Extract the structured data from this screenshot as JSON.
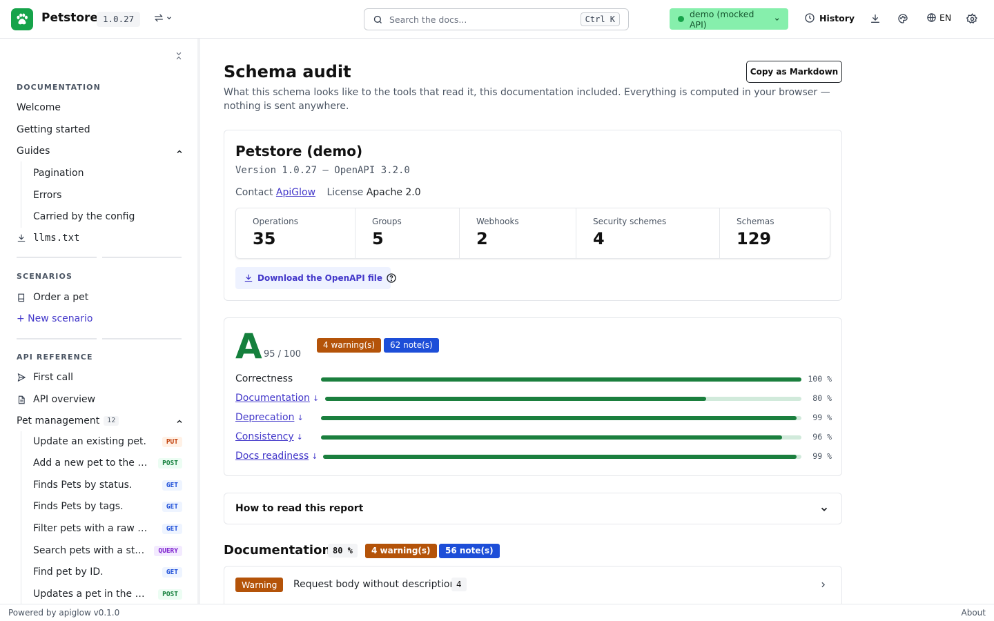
{
  "header": {
    "brand": "Petstore",
    "version": "1.0.27",
    "search_placeholder": "Search the docs...",
    "search_shortcut": "Ctrl K",
    "environment": "demo (mocked API)",
    "history_label": "History",
    "language": "EN"
  },
  "sidebar": {
    "documentation_title": "DOCUMENTATION",
    "doc_items": [
      "Welcome",
      "Getting started",
      "Guides"
    ],
    "guide_items": [
      "Pagination",
      "Errors",
      "Carried by the config"
    ],
    "llms_label": "llms.txt",
    "scenarios_title": "SCENARIOS",
    "scenario_item": "Order a pet",
    "new_scenario": "+ New scenario",
    "api_title": "API REFERENCE",
    "api_items": [
      "First call",
      "API overview"
    ],
    "group_label": "Pet management",
    "group_count": "12",
    "operations": [
      {
        "name": "Update an existing pet.",
        "method": "PUT"
      },
      {
        "name": "Add a new pet to the st...",
        "method": "POST"
      },
      {
        "name": "Finds Pets by status.",
        "method": "GET"
      },
      {
        "name": "Finds Pets by tags.",
        "method": "GET"
      },
      {
        "name": "Filter pets with a raw qu...",
        "method": "GET"
      },
      {
        "name": "Search pets with a stru...",
        "method": "QUERY"
      },
      {
        "name": "Find pet by ID.",
        "method": "GET"
      },
      {
        "name": "Updates a pet in the st...",
        "method": "POST"
      }
    ]
  },
  "main": {
    "title": "Schema audit",
    "copy_button": "Copy as Markdown",
    "intro": "What this schema looks like to the tools that read it, this documentation included. Everything is computed in your browser — nothing is sent anywhere.",
    "api": {
      "title": "Petstore (demo)",
      "version_line": "Version 1.0.27 — OpenAPI 3.2.0",
      "contact_label": "Contact",
      "contact_value": "ApiGlow",
      "license_label": "License",
      "license_value": "Apache 2.0",
      "stats": [
        {
          "label": "Operations",
          "value": "35"
        },
        {
          "label": "Groups",
          "value": "5"
        },
        {
          "label": "Webhooks",
          "value": "2"
        },
        {
          "label": "Security schemes",
          "value": "4"
        },
        {
          "label": "Schemas",
          "value": "129"
        }
      ],
      "download_label": "Download the OpenAPI file"
    },
    "score": {
      "grade": "A",
      "score_text": "95 / 100",
      "warnings": "4 warning(s)",
      "notes": "62 note(s)",
      "rows": [
        {
          "label": "Correctness",
          "link": false,
          "value": 100,
          "pct_text": "100 %"
        },
        {
          "label": "Documentation",
          "link": true,
          "value": 80,
          "pct_text": "80 %"
        },
        {
          "label": "Deprecation",
          "link": true,
          "value": 99,
          "pct_text": "99 %"
        },
        {
          "label": "Consistency",
          "link": true,
          "value": 96,
          "pct_text": "96 %"
        },
        {
          "label": "Docs readiness",
          "link": true,
          "value": 99,
          "pct_text": "99 %"
        }
      ]
    },
    "how_to_read": "How to read this report",
    "section": {
      "title": "Documentation",
      "pct": "80 %",
      "warnings": "4 warning(s)",
      "notes": "56 note(s)"
    },
    "issue": {
      "severity": "Warning",
      "text": "Request body without description",
      "count": "4"
    }
  },
  "footer": {
    "powered": "Powered by apiglow v0.1.0",
    "about": "About"
  },
  "colors": {
    "brand": "#16a34a",
    "link": "#4338ca",
    "warning": "#b45309",
    "note": "#1d4ed8",
    "bar": "#1b7f3e"
  }
}
